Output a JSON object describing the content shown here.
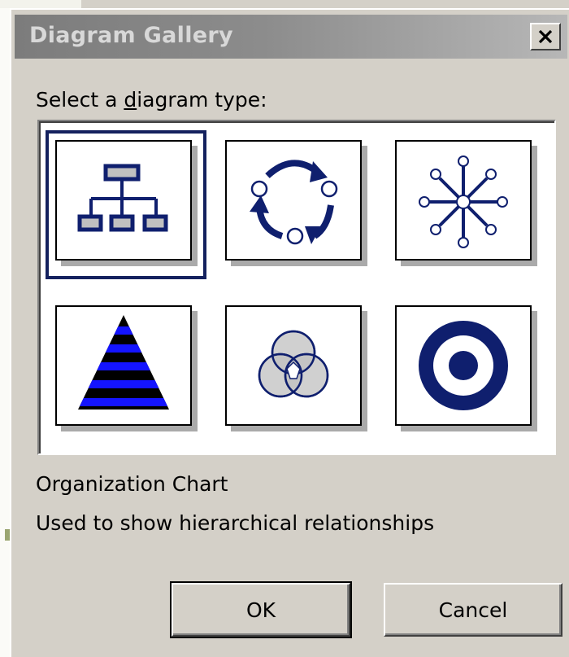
{
  "window": {
    "title": "Diagram Gallery",
    "close_icon": "close-x-icon"
  },
  "prompt": {
    "before": "Select a ",
    "accelerator": "d",
    "after": "iagram type:"
  },
  "gallery": {
    "selected": "Organization Chart",
    "items": [
      {
        "name": "Organization Chart",
        "icon": "org-chart-icon"
      },
      {
        "name": "Cycle Diagram",
        "icon": "cycle-diagram-icon"
      },
      {
        "name": "Radial Diagram",
        "icon": "radial-diagram-icon"
      },
      {
        "name": "Pyramid Diagram",
        "icon": "pyramid-diagram-icon"
      },
      {
        "name": "Venn Diagram",
        "icon": "venn-diagram-icon"
      },
      {
        "name": "Target Diagram",
        "icon": "target-diagram-icon"
      }
    ]
  },
  "description": {
    "name": "Organization Chart",
    "text": "Used to show hierarchical relationships"
  },
  "buttons": {
    "ok": "OK",
    "cancel": "Cancel"
  },
  "colors": {
    "title_bar": "#8c8c8c",
    "accent_navy": "#0f1f6e",
    "accent_blue": "#1414ff",
    "selection_border": "#14215e",
    "dialog_bg": "#d4d0c8"
  }
}
